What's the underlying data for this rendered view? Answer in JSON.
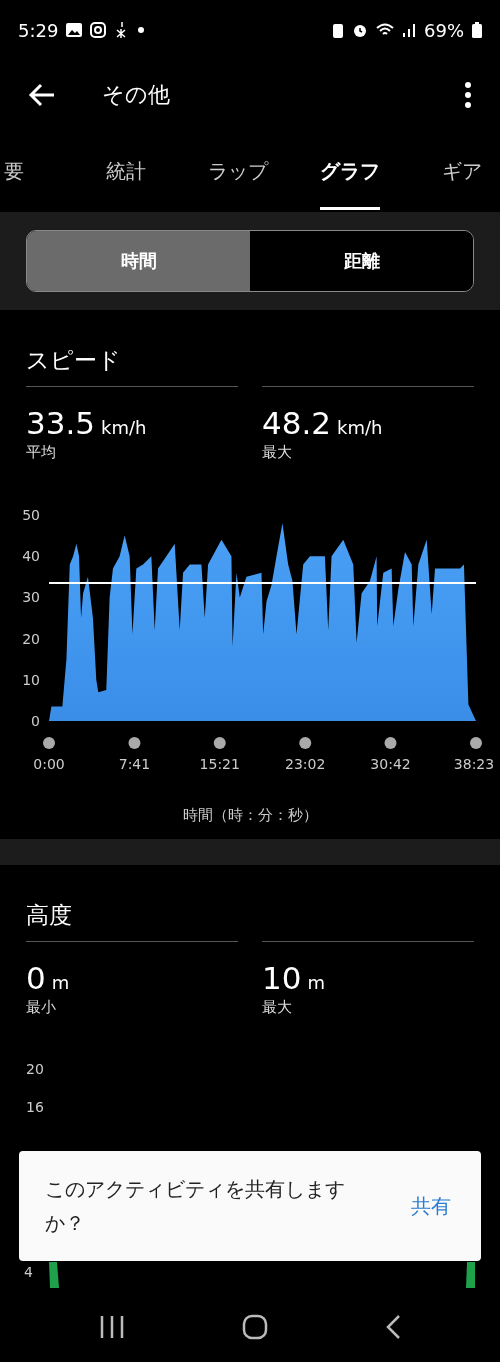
{
  "status_bar": {
    "time": "5:29",
    "battery": "69%"
  },
  "header": {
    "title": "その他"
  },
  "tabs": [
    {
      "label": "要",
      "selected": false
    },
    {
      "label": "統計",
      "selected": false
    },
    {
      "label": "ラップ",
      "selected": false
    },
    {
      "label": "グラフ",
      "selected": true
    },
    {
      "label": "ギア",
      "selected": false
    }
  ],
  "segments": [
    {
      "label": "時間",
      "selected": true
    },
    {
      "label": "距離",
      "selected": false
    }
  ],
  "speed": {
    "title": "スピード",
    "stats": [
      {
        "value": "33.5",
        "unit": "km/h",
        "label": "平均"
      },
      {
        "value": "48.2",
        "unit": "km/h",
        "label": "最大"
      }
    ],
    "chart_data": {
      "type": "area",
      "xlabel": "時間（時：分：秒）",
      "ylim": [
        0,
        50
      ],
      "yticks": [
        0,
        10,
        20,
        30,
        40,
        50
      ],
      "xlim": [
        0,
        2303
      ],
      "xticks": [
        {
          "value": 0,
          "label": "0:00"
        },
        {
          "value": 461,
          "label": "7:41"
        },
        {
          "value": 921,
          "label": "15:21"
        },
        {
          "value": 1382,
          "label": "23:02"
        },
        {
          "value": 1842,
          "label": "30:42"
        },
        {
          "value": 2303,
          "label": "38:23"
        }
      ],
      "x": [
        0,
        13,
        72,
        94,
        112,
        130,
        148,
        162,
        173,
        184,
        210,
        237,
        255,
        266,
        309,
        327,
        345,
        381,
        408,
        435,
        450,
        471,
        507,
        552,
        570,
        588,
        633,
        678,
        705,
        723,
        759,
        822,
        840,
        858,
        930,
        984,
        990,
        1011,
        1029,
        1065,
        1146,
        1155,
        1173,
        1200,
        1227,
        1259,
        1290,
        1313,
        1335,
        1371,
        1407,
        1488,
        1506,
        1524,
        1587,
        1641,
        1659,
        1686,
        1731,
        1767,
        1770,
        1803,
        1848,
        1857,
        1884,
        1920,
        1956,
        1965,
        1992,
        2037,
        2064,
        2082,
        2145,
        2217,
        2238,
        2262,
        2303
      ],
      "series": [
        {
          "color": "#3a8ee8",
          "values": [
            0,
            3.5,
            3.5,
            15,
            38,
            40,
            43,
            40,
            25,
            31,
            35,
            25,
            10,
            7,
            7.5,
            30,
            37,
            40,
            45,
            40,
            21,
            37,
            38,
            40,
            22,
            37,
            40,
            43,
            22,
            36,
            38,
            38,
            25,
            38,
            44,
            40,
            18,
            36,
            30,
            35,
            36,
            21,
            29,
            33,
            40,
            48,
            38,
            34,
            21,
            38,
            40,
            40,
            22,
            40,
            44,
            38,
            19,
            31,
            34,
            40,
            23,
            36,
            37,
            23,
            32,
            41,
            38,
            23,
            38,
            44,
            26,
            37,
            37,
            37,
            38,
            4,
            0
          ]
        }
      ],
      "ref_lines": [
        {
          "axis": "y",
          "value": 33.5,
          "color": "#ffffff"
        }
      ]
    }
  },
  "altitude": {
    "title": "高度",
    "stats": [
      {
        "value": "0",
        "unit": "m",
        "label": "最小"
      },
      {
        "value": "10",
        "unit": "m",
        "label": "最大"
      }
    ],
    "y_ticks": [
      "20",
      "16",
      "4"
    ]
  },
  "toast": {
    "message": "このアクティビティを共有しますか？",
    "action": "共有"
  }
}
